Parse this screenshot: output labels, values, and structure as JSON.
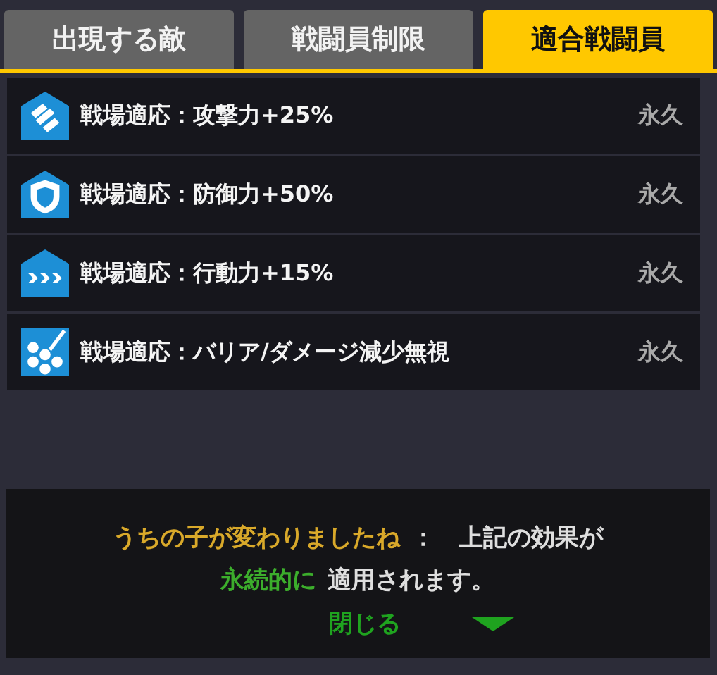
{
  "tabs": [
    {
      "label": "出現する敵",
      "selected": false
    },
    {
      "label": "戦闘員制限",
      "selected": false
    },
    {
      "label": "適合戦闘員",
      "selected": true
    }
  ],
  "effects": [
    {
      "kind": "attack",
      "label": "戦場適応：攻撃力+25%",
      "duration": "永久"
    },
    {
      "kind": "defense",
      "label": "戦場適応：防御力+50%",
      "duration": "永久"
    },
    {
      "kind": "action",
      "label": "戦場適応：行動力+15%",
      "duration": "永久"
    },
    {
      "kind": "pierce",
      "label": "戦場適応：バリア/ダメージ減少無視",
      "duration": "永久"
    }
  ],
  "message": {
    "lines": [
      [
        {
          "kind": "speaker",
          "text": "うちの子が変わりましたね"
        },
        {
          "kind": "plain",
          "text": "：　上記の効果が"
        }
      ],
      [
        {
          "kind": "highlight",
          "text": "永続的に"
        },
        {
          "kind": "plain",
          "text": "適用されます。"
        }
      ]
    ],
    "close": "閉じる"
  }
}
